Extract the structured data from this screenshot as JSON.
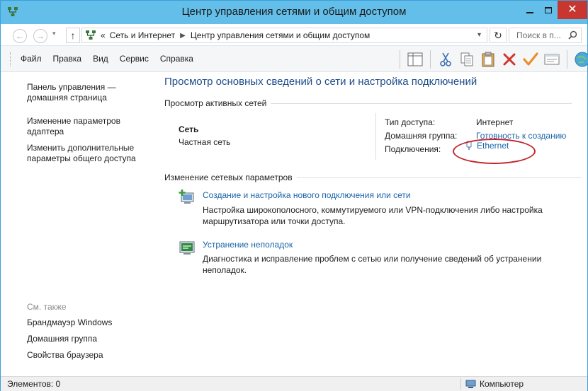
{
  "window": {
    "title": "Центр управления сетями и общим доступом",
    "accent_color": "#63bfe9",
    "app_icon": "network-center-icon"
  },
  "address": {
    "back_icon": "arrow-left-icon",
    "forward_icon": "arrow-right-icon",
    "up_icon": "arrow-up-icon",
    "overflow": "«",
    "breadcrumb": [
      "Сеть и Интернет",
      "Центр управления сетями и общим доступом"
    ],
    "search_placeholder": "Поиск в п..."
  },
  "menu": {
    "items": [
      "Файл",
      "Правка",
      "Вид",
      "Сервис",
      "Справка"
    ]
  },
  "toolbar": {
    "icons": [
      "layout-icon",
      "cut-icon",
      "copy-icon",
      "paste-icon",
      "delete-icon",
      "check-icon",
      "properties-icon",
      "globe-icon"
    ]
  },
  "sidebar": {
    "links": [
      "Панель управления — домашняя страница",
      "Изменение параметров адаптера",
      "Изменить дополнительные параметры общего доступа"
    ],
    "see_also_title": "См. также",
    "see_also": [
      "Брандмауэр Windows",
      "Домашняя группа",
      "Свойства браузера"
    ]
  },
  "main": {
    "title": "Просмотр основных сведений о сети и настройка подключений",
    "active_networks_heading": "Просмотр активных сетей",
    "network": {
      "name": "Сеть",
      "type": "Частная сеть",
      "access_type_label": "Тип доступа:",
      "access_type_value": "Интернет",
      "homegroup_label": "Домашняя группа:",
      "homegroup_value": "Готовность к созданию",
      "connections_label": "Подключения:",
      "connection_value": "Ethernet"
    },
    "change_settings_heading": "Изменение сетевых параметров",
    "tasks": [
      {
        "link": "Создание и настройка нового подключения или сети",
        "description": "Настройка широкополосного, коммутируемого или VPN-подключения либо настройка маршрутизатора или точки доступа.",
        "icon": "new-connection-icon"
      },
      {
        "link": "Устранение неполадок",
        "description": "Диагностика и исправление проблем с сетью или получение сведений об устранении неполадок.",
        "icon": "troubleshoot-icon"
      }
    ]
  },
  "status": {
    "items_text": "Элементов: 0",
    "location": "Компьютер"
  }
}
